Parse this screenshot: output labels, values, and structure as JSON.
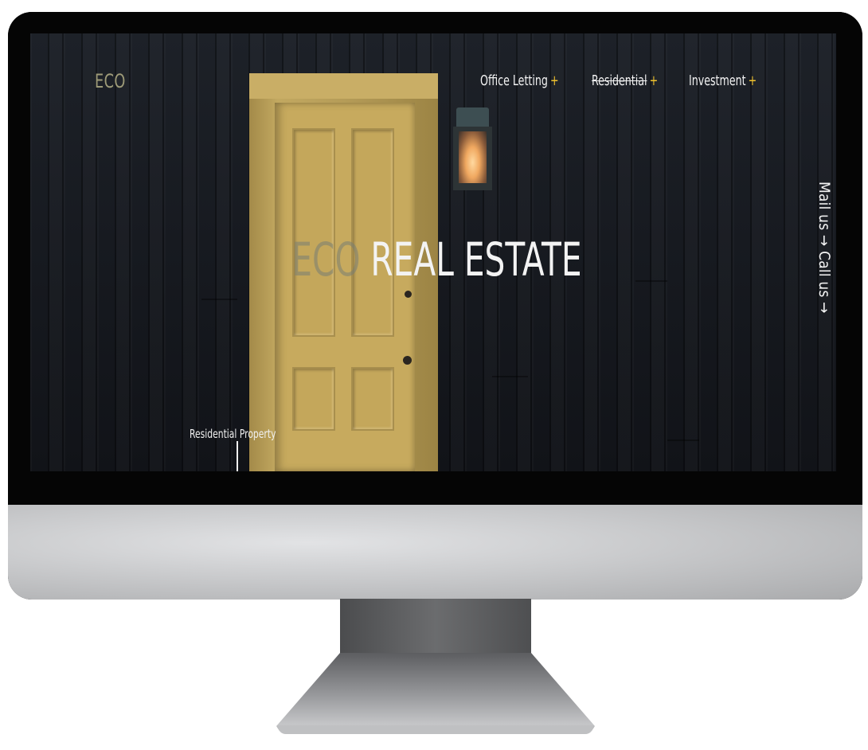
{
  "site": {
    "logo": "ECO",
    "nav": [
      {
        "label": "Office Letting",
        "plus": "+"
      },
      {
        "label": "Residential",
        "plus": "+"
      },
      {
        "label": "Investment",
        "plus": "+"
      }
    ],
    "hero": {
      "title_muted": "ECO",
      "title_main": "REAL ESTATE"
    },
    "side_contact": "Mail us → Call us →",
    "caption": "Residential Property"
  },
  "colors": {
    "accent": "#f1c22e",
    "door": "#c7aa5e",
    "logo": "#9e9b78"
  }
}
